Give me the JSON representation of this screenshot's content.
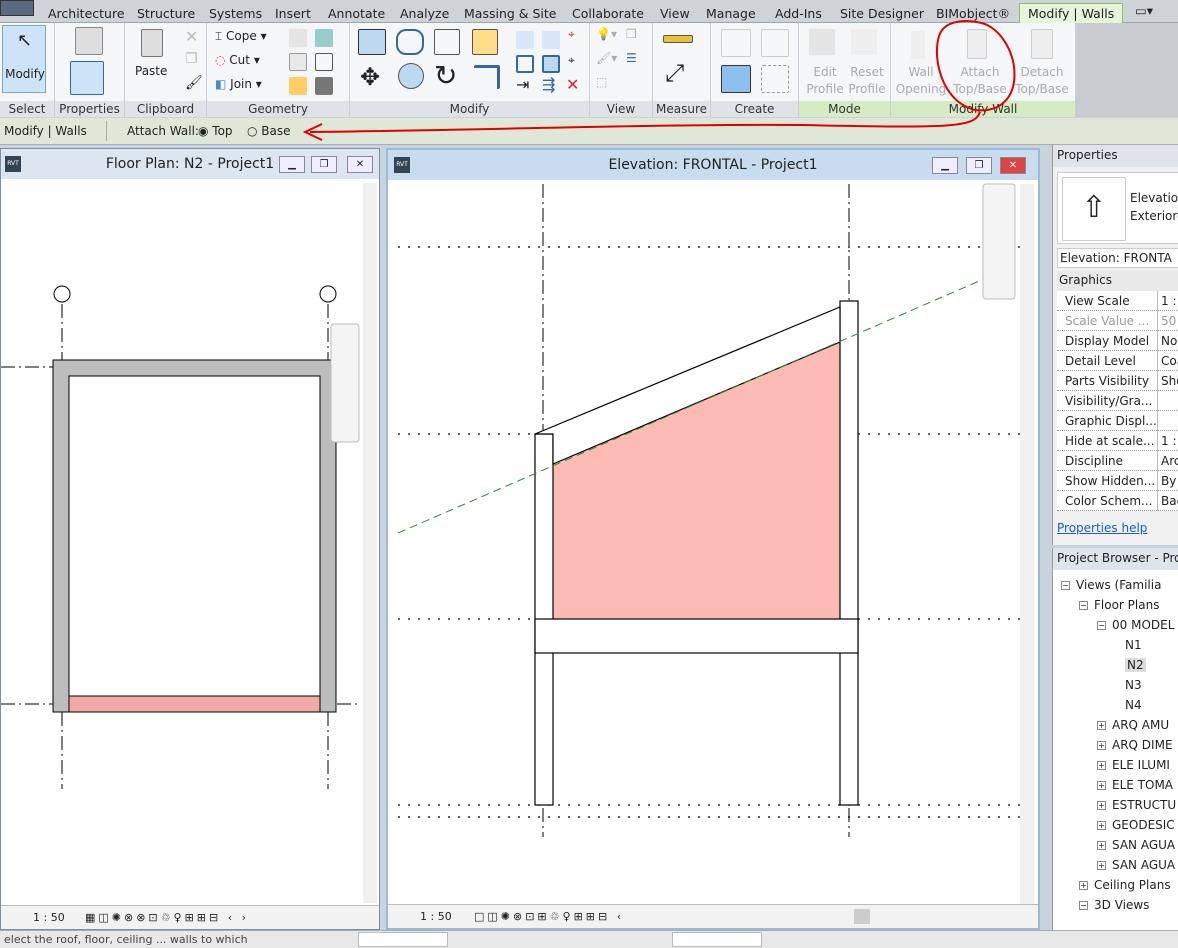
{
  "tabs": [
    "Architecture",
    "Structure",
    "Systems",
    "Insert",
    "Annotate",
    "Analyze",
    "Massing & Site",
    "Collaborate",
    "View",
    "Manage",
    "Add-Ins",
    "Site Designer",
    "BIMobject®",
    "Modify | Walls"
  ],
  "ribbon": {
    "select": {
      "button": "Modify",
      "label": "Select"
    },
    "properties": {
      "label": "Properties"
    },
    "clipboard": {
      "paste": "Paste",
      "label": "Clipboard"
    },
    "geometry": {
      "cope": "Cope",
      "cut": "Cut",
      "join": "Join",
      "label": "Geometry"
    },
    "modify": {
      "label": "Modify"
    },
    "view": {
      "label": "View"
    },
    "measure": {
      "label": "Measure"
    },
    "create": {
      "label": "Create"
    },
    "mode": {
      "edit_profile": "Edit Profile",
      "reset_profile": "Reset Profile",
      "label": "Mode"
    },
    "modify_wall": {
      "wall_opening": "Wall Opening",
      "attach": "Attach Top/Base",
      "detach": "Detach Top/Base",
      "label": "Modify Wall"
    }
  },
  "options_bar": {
    "context": "Modify | Walls",
    "attach_label": "Attach Wall:",
    "option_top": "Top",
    "option_base": "Base",
    "selected": "Top"
  },
  "floor_plan": {
    "title": "Floor Plan: N2 - Project1",
    "scale": "1 : 50"
  },
  "elevation": {
    "title": "Elevation: FRONTAL - Project1",
    "scale": "1 : 50"
  },
  "properties": {
    "title": "Properties",
    "type_name": "Elevation",
    "type_sub": "Exteriore",
    "selector": "Elevation: FRONTA",
    "group": "Graphics",
    "rows": [
      {
        "k": "View Scale",
        "v": "1 :"
      },
      {
        "k": "Scale Value ...",
        "v": "50"
      },
      {
        "k": "Display Model",
        "v": "Nor"
      },
      {
        "k": "Detail Level",
        "v": "Coa"
      },
      {
        "k": "Parts Visibility",
        "v": "Sho"
      },
      {
        "k": "Visibility/Gra...",
        "v": ""
      },
      {
        "k": "Graphic Displ...",
        "v": ""
      },
      {
        "k": "Hide at scale...",
        "v": "1 :"
      },
      {
        "k": "Discipline",
        "v": "Arch"
      },
      {
        "k": "Show Hidden...",
        "v": "By D"
      },
      {
        "k": "Color Schem...",
        "v": "Bac"
      }
    ],
    "help": "Properties help"
  },
  "browser": {
    "title": "Project Browser - Projec",
    "items": [
      "Views (Familia",
      "Floor Plans",
      "00 MODEL",
      "N1",
      "N2",
      "N3",
      "N4",
      "ARQ AMU",
      "ARQ DIME",
      "ELE ILUMI",
      "ELE TOMA",
      "ESTRUCTU",
      "GEODESIC",
      "SAN AGUA",
      "SAN AGUA",
      "Ceiling Plans",
      "3D Views"
    ],
    "selected": "N2"
  },
  "status": {
    "text": "elect the roof, floor, ceiling ... walls to which"
  },
  "colors": {
    "annotation": "#e00000",
    "pink_fill": "#fbbab3",
    "green_dash": "#2a8a2a",
    "tab_active": "#e8f3dc"
  }
}
